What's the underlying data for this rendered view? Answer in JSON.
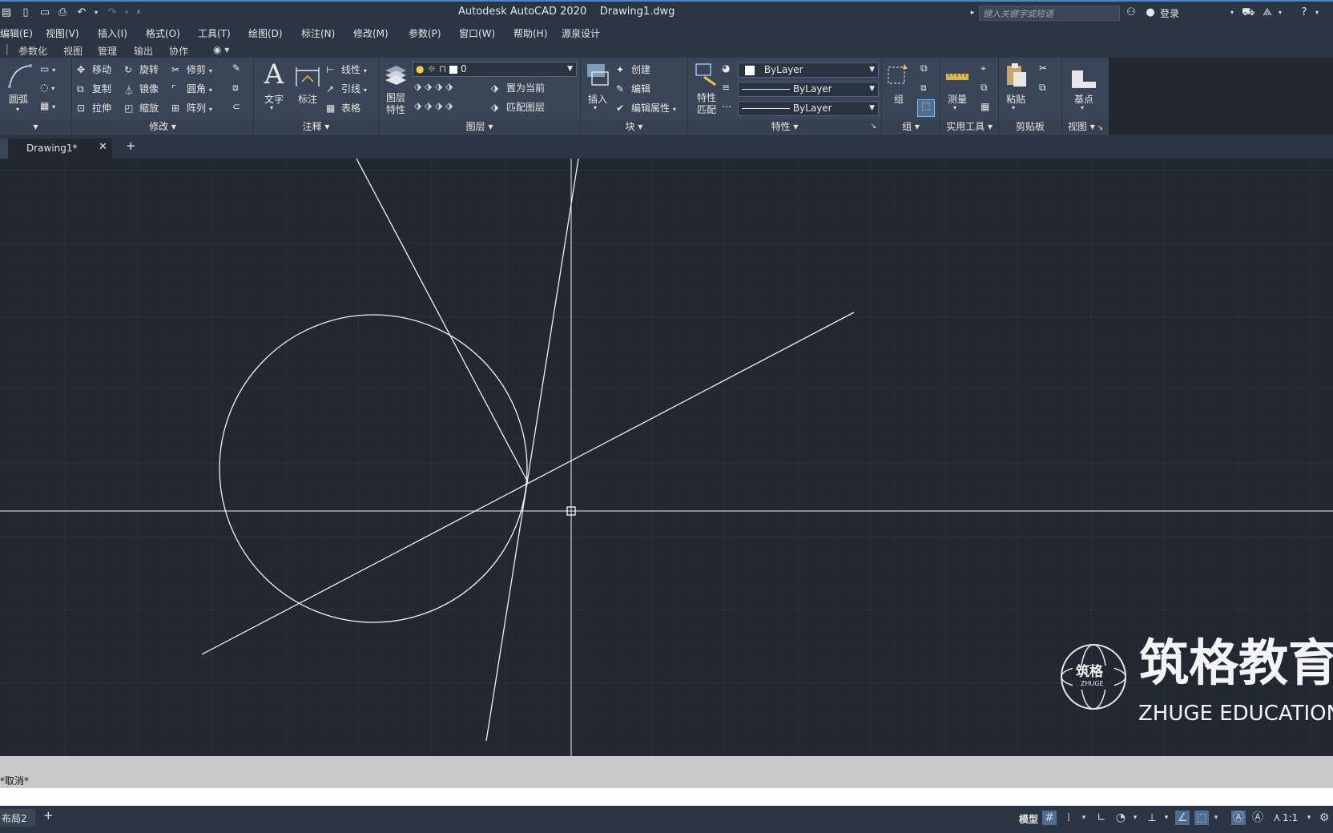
{
  "titlebar": {
    "app_title": "Autodesk AutoCAD 2020",
    "file_name": "Drawing1.dwg",
    "search_placeholder": "键入关键字或短语",
    "login_label": "登录"
  },
  "menu": [
    "编辑(E)",
    "视图(V)",
    "插入(I)",
    "格式(O)",
    "工具(T)",
    "绘图(D)",
    "标注(N)",
    "修改(M)",
    "参数(P)",
    "窗口(W)",
    "帮助(H)",
    "源泉设计"
  ],
  "ribbon_tabs": [
    "参数化",
    "视图",
    "管理",
    "输出",
    "协作"
  ],
  "ribbon": {
    "draw": {
      "arc_label": "圆弧"
    },
    "modify": {
      "title": "修改",
      "move": "移动",
      "rotate": "旋转",
      "trim": "修剪",
      "copy": "复制",
      "mirror": "镜像",
      "fillet": "圆角",
      "stretch": "拉伸",
      "scale": "缩放",
      "array": "阵列"
    },
    "annotation": {
      "title": "注释",
      "text": "文字",
      "dimension": "标注",
      "linear": "线性",
      "leader": "引线",
      "table": "表格"
    },
    "layers": {
      "title": "图层",
      "layer_props_line1": "图层",
      "layer_props_line2": "特性",
      "current_layer": "0",
      "set_current": "置为当前",
      "match_layer": "匹配图层"
    },
    "block": {
      "title": "块",
      "insert": "插入",
      "create": "创建",
      "edit": "编辑",
      "edit_attributes": "编辑属性"
    },
    "properties": {
      "title": "特性",
      "match_line1": "特性",
      "match_line2": "匹配",
      "color": "ByLayer",
      "linetype": "ByLayer",
      "lineweight": "ByLayer"
    },
    "groups": {
      "title": "组",
      "group": "组"
    },
    "utilities": {
      "title": "实用工具",
      "measure": "测量"
    },
    "clipboard": {
      "title": "剪贴板",
      "paste": "粘贴"
    },
    "view": {
      "title": "视图",
      "base": "基点"
    }
  },
  "file_tab": {
    "name": "Drawing1*"
  },
  "watermark": {
    "brand_cn": "筑格教育",
    "brand_en": "ZHUGE EDUCATION",
    "logo_cn": "筑格",
    "logo_en": "ZHUGE"
  },
  "command": {
    "history_text": "*取消*"
  },
  "statusbar": {
    "layout_tab": "布局2",
    "model_label": "模型",
    "scale": "1:1"
  },
  "colors": {
    "canvas": "#212830",
    "ribbon": "#3a4657",
    "titlebar": "#2b3544",
    "drawing_lines": "#f0f0f0"
  }
}
